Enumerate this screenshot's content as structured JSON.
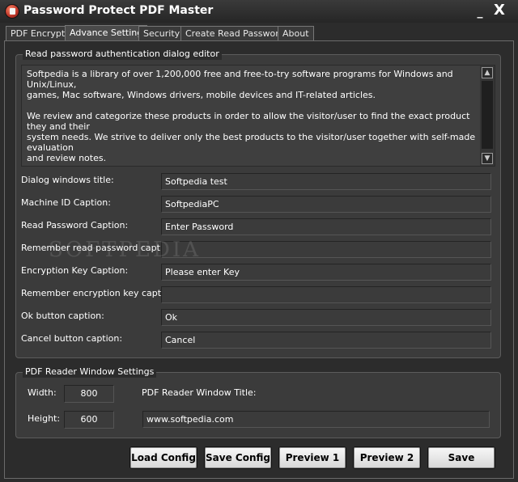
{
  "window": {
    "title": "Password Protect PDF Master",
    "minimize": "_",
    "close": "X"
  },
  "tabs": [
    {
      "label": "PDF Encrypt"
    },
    {
      "label": "Advance Setting",
      "active": true
    },
    {
      "label": "Security"
    },
    {
      "label": "Create Read Password"
    },
    {
      "label": "About"
    }
  ],
  "editor_group": {
    "title": "Read password authentication dialog editor",
    "text": "Softpedia is a library of over 1,200,000 free and free-to-try software programs for Windows and Unix/Linux,\ngames, Mac software, Windows drivers, mobile devices and IT-related articles.\n\nWe review and categorize these products in order to allow the visitor/user to find the exact product they and their\nsystem needs. We strive to deliver only the best products to the visitor/user together with self-made evaluation\nand review notes.\n\nwww.softpedia.com",
    "scroll_up": "▲",
    "scroll_down": "▼"
  },
  "fields": [
    {
      "label": "Dialog windows title:",
      "value": "Softpedia test"
    },
    {
      "label": "Machine ID Caption:",
      "value": "SoftpediaPC"
    },
    {
      "label": "Read Password Caption:",
      "value": "Enter Password"
    },
    {
      "label": "Remember read password caption:",
      "value": ""
    },
    {
      "label": "Encryption Key Caption:",
      "value": "Please enter Key"
    },
    {
      "label": "Remember encryption key caption:",
      "value": ""
    },
    {
      "label": "Ok button caption:",
      "value": "Ok"
    },
    {
      "label": "Cancel button caption:",
      "value": "Cancel"
    }
  ],
  "reader_group": {
    "title": "PDF Reader Window Settings",
    "width_label": "Width:",
    "width_value": "800",
    "height_label": "Height:",
    "height_value": "600",
    "window_title_label": "PDF Reader Window Title:",
    "window_title_value": "www.softpedia.com"
  },
  "watermark": "SOFTPEDIA",
  "buttons": {
    "load_config": "Load Config",
    "save_config": "Save Config",
    "preview1": "Preview 1",
    "preview2": "Preview 2",
    "save": "Save"
  },
  "colors": {
    "background": "#2c2c2c",
    "group": "#3b3b3b",
    "button": "#e8e8e8"
  },
  "icons": {
    "app": "pdf-lock-icon"
  }
}
